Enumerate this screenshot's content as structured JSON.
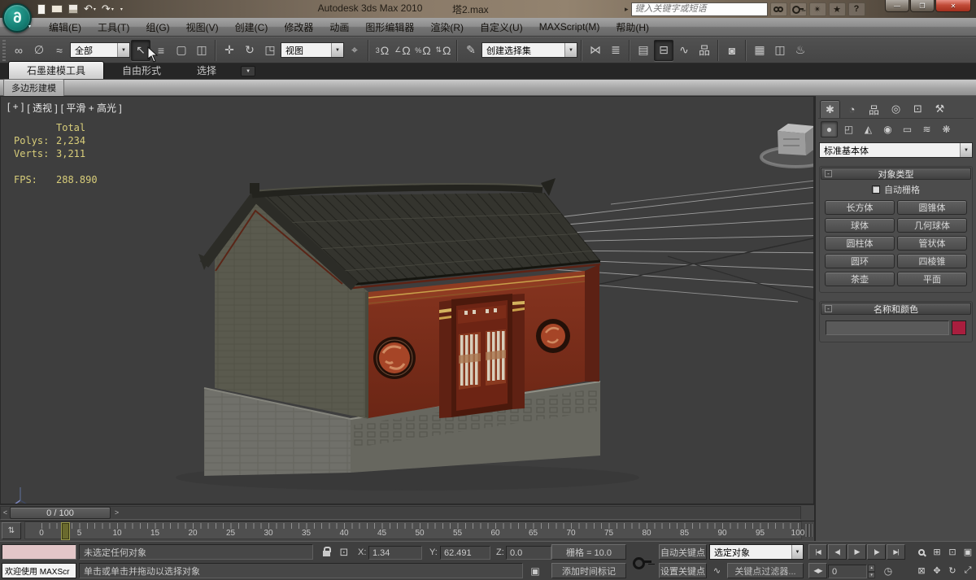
{
  "titlebar": {
    "app_title": "Autodesk 3ds Max 2010",
    "file_name": "塔2.max",
    "search_placeholder": "键入关键字或短语"
  },
  "menubar": {
    "items": [
      "编辑(E)",
      "工具(T)",
      "组(G)",
      "视图(V)",
      "创建(C)",
      "修改器",
      "动画",
      "图形编辑器",
      "渲染(R)",
      "自定义(U)",
      "MAXScript(M)",
      "帮助(H)"
    ]
  },
  "toolbar": {
    "filter_value": "全部",
    "coord_value": "视图",
    "selection_set_value": "创建选择集",
    "snap_label": "3"
  },
  "ribbon": {
    "tabs": [
      "石墨建模工具",
      "自由形式",
      "选择"
    ],
    "panel_button": "多边形建模"
  },
  "viewport": {
    "label_segments": [
      "[ + ]",
      "[ 透视 ]",
      "[ 平滑 + 高光 ]"
    ],
    "stats": {
      "total": "Total",
      "polys_label": "Polys:",
      "polys_value": "2,234",
      "verts_label": "Verts:",
      "verts_value": "3,211",
      "fps_label": "FPS:",
      "fps_value": "288.890"
    }
  },
  "command_panel": {
    "category_dropdown": "标准基本体",
    "object_type": {
      "title": "对象类型",
      "autogrid": "自动栅格",
      "buttons": [
        "长方体",
        "圆锥体",
        "球体",
        "几何球体",
        "圆柱体",
        "管状体",
        "圆环",
        "四棱锥",
        "茶壶",
        "平面"
      ]
    },
    "name_color": {
      "title": "名称和颜色",
      "name_value": "",
      "swatch_color": "#a91e3e"
    }
  },
  "timeline": {
    "slider_label": "0 / 100",
    "tick_labels": [
      0,
      5,
      10,
      15,
      20,
      25,
      30,
      35,
      40,
      45,
      50,
      55,
      60,
      65,
      70,
      75,
      80,
      85,
      90,
      95,
      100
    ]
  },
  "statusbar": {
    "welcome": "欢迎使用 MAXScr",
    "status": "未选定任何对象",
    "prompt": "单击或单击并拖动以选择对象",
    "x_label": "X:",
    "x_value": "1.34",
    "y_label": "Y:",
    "y_value": "62.491",
    "z_label": "Z:",
    "z_value": "0.0",
    "grid_label": "栅格 = 10.0",
    "add_time_tag": "添加时间标记",
    "auto_key": "自动关键点",
    "set_key": "设置关键点",
    "key_selection": "选定对象",
    "key_filters": "关键点过滤器...",
    "frame_value": "0"
  },
  "colors": {
    "swatch": "#a91e3e",
    "stats_text": "#d8cd7a",
    "timeline_handle": "#6a6a2e"
  },
  "icons": {
    "logo": "6",
    "undo": "↶",
    "redo": "↷",
    "qat_arrow": "▾",
    "search_collapse": "▸",
    "satellite": "✴",
    "star": "★",
    "help": "?",
    "min": "—",
    "max": "❐",
    "close": "✕",
    "link": "∞",
    "unlink": "∅",
    "bind": "≈",
    "select": "↖",
    "select_by_name": "≡",
    "region": "▢",
    "window_crossing": "◫",
    "move": "✛",
    "rotate": "↻",
    "scale": "◳",
    "manipulate": "⌖",
    "magnet": "Ω",
    "snap_angle": "∠",
    "snap_percent": "%",
    "snap_spinner": "⇅",
    "named_sel": "✎",
    "mirror": "⋈",
    "align": "≣",
    "layers": "▤",
    "graphite": "⊟",
    "curve_editor": "∿",
    "schematic": "品",
    "material": "◙",
    "render_setup": "▦",
    "rendered_frame": "◫",
    "render": "♨",
    "tab_create": "✱",
    "tab_modify": "◔",
    "tab_hierarchy": "品",
    "tab_motion": "◎",
    "tab_display": "⊡",
    "tab_utilities": "⚒",
    "cat_geometry": "●",
    "cat_shapes": "◰",
    "cat_lights": "◭",
    "cat_cameras": "◉",
    "cat_helpers": "▭",
    "cat_spacewarps": "≋",
    "cat_systems": "❋",
    "dd_arrow": "▼",
    "ro_minus": "-",
    "ts_left": "<",
    "ts_right": ">",
    "tb_curve": "⇅",
    "abs_offset": "⊡",
    "cube": "▣",
    "goto_start": "|◀",
    "prev": "◀|",
    "play": "▶",
    "next": "|▶",
    "goto_end": "▶|",
    "key_mode": "◀▶",
    "spin_up": "▴",
    "spin_down": "▾",
    "time_config": "◷",
    "zoom_all": "⊞",
    "zoom_extents": "⊡",
    "zoom_extents_all": "▣",
    "zoom_region": "⊠",
    "pan": "✥",
    "orbit": "↻",
    "maximize": "⤢"
  }
}
